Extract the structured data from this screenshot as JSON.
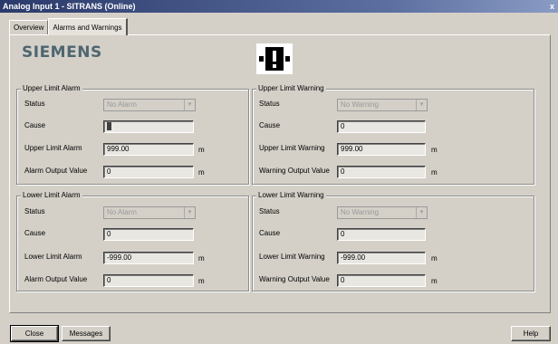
{
  "window": {
    "title": "Analog Input 1 - SITRANS  (Online)",
    "close_glyph": "x"
  },
  "tabs": [
    {
      "label": "Overview"
    },
    {
      "label": "Alarms and Warnings"
    }
  ],
  "brand": {
    "logo_text": "SIEMENS"
  },
  "icon": {
    "name": "alert-icon"
  },
  "upper_alarm": {
    "title": "Upper Limit Alarm",
    "status_label": "Status",
    "status_value": "No Alarm",
    "cause_label": "Cause",
    "cause_value": "",
    "limit_label": "Upper Limit Alarm",
    "limit_value": "999.00",
    "limit_unit": "m",
    "output_label": "Alarm Output Value",
    "output_value": "0",
    "output_unit": "m"
  },
  "upper_warning": {
    "title": "Upper Limit Warning",
    "status_label": "Status",
    "status_value": "No Warning",
    "cause_label": "Cause",
    "cause_value": "0",
    "limit_label": "Upper Limit Warning",
    "limit_value": "999.00",
    "limit_unit": "m",
    "output_label": "Warning Output Value",
    "output_value": "0",
    "output_unit": "m"
  },
  "lower_alarm": {
    "title": "Lower Limit Alarm",
    "status_label": "Status",
    "status_value": "No Alarm",
    "cause_label": "Cause",
    "cause_value": "0",
    "limit_label": "Lower Limit Alarm",
    "limit_value": "-999.00",
    "limit_unit": "m",
    "output_label": "Alarm Output Value",
    "output_value": "0",
    "output_unit": "m"
  },
  "lower_warning": {
    "title": "Lower Limit Warning",
    "status_label": "Status",
    "status_value": "No Warning",
    "cause_label": "Cause",
    "cause_value": "0",
    "limit_label": "Lower Limit Warning",
    "limit_value": "-999.00",
    "limit_unit": "m",
    "output_label": "Warning Output Value",
    "output_value": "0",
    "output_unit": "m"
  },
  "footer": {
    "close_label": "Close",
    "messages_label": "Messages",
    "help_label": "Help"
  }
}
